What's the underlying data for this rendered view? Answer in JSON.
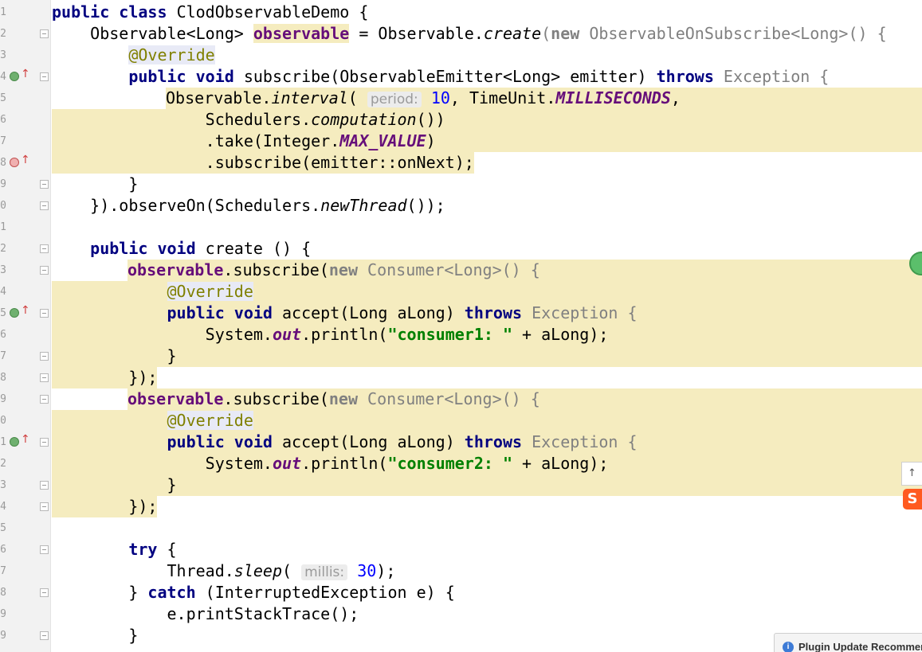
{
  "gutter": {
    "line_numbers": [
      "1",
      "2",
      "3",
      "4",
      "5",
      "6",
      "7",
      "8",
      "9",
      "0",
      "1",
      "2",
      "3",
      "4",
      "5",
      "6",
      "7",
      "8",
      "9",
      "0",
      "1",
      "2",
      "3",
      "4",
      "5",
      "6",
      "7",
      "8",
      "9",
      "9"
    ]
  },
  "code": {
    "l1": [
      "public",
      "class",
      "ClodObservableDemo {"
    ],
    "l2": [
      "Observable<Long> ",
      "observable",
      " = Observable.",
      "create",
      "(",
      "new",
      " ObservableOnSubscribe<Long>() {"
    ],
    "l3": [
      "@Override"
    ],
    "l4": [
      "public",
      "void",
      " subscribe(ObservableEmitter<Long> emitter) ",
      "throws",
      " Exception {"
    ],
    "l5": [
      "Observable.",
      "interval",
      "(",
      "period:",
      "10",
      ", TimeUnit.",
      "MILLISECONDS",
      ","
    ],
    "l6": [
      "Schedulers.",
      "computation",
      "())"
    ],
    "l7": [
      ".take(Integer.",
      "MAX_VALUE",
      ")"
    ],
    "l8": [
      ".subscribe(emitter::onNext);"
    ],
    "l9": [
      "}"
    ],
    "l10": [
      "}).observeOn(Schedulers.",
      "newThread",
      "());"
    ],
    "l12": [
      "public",
      "void",
      " create () {"
    ],
    "l13": [
      "observable",
      ".subscribe(",
      "new",
      " Consumer<Long>() {"
    ],
    "l14": [
      "@Override"
    ],
    "l15": [
      "public",
      "void",
      " accept(Long aLong) ",
      "throws",
      " Exception {"
    ],
    "l16": [
      "System.",
      "out",
      ".println(",
      "\"consumer1: \"",
      " + aLong);"
    ],
    "l17": [
      "}"
    ],
    "l18": [
      "});"
    ],
    "l19": [
      "observable",
      ".subscribe(",
      "new",
      " Consumer<Long>() {"
    ],
    "l20": [
      "@Override"
    ],
    "l21": [
      "public",
      "void",
      " accept(Long aLong) ",
      "throws",
      " Exception {"
    ],
    "l22": [
      "System.",
      "out",
      ".println(",
      "\"consumer2: \"",
      " + aLong);"
    ],
    "l23": [
      "}"
    ],
    "l24": [
      "});"
    ],
    "l26": [
      "try",
      " {"
    ],
    "l27": [
      "Thread.",
      "sleep",
      "(",
      "millis:",
      "30",
      ");"
    ],
    "l28": [
      "} ",
      "catch",
      " (InterruptedException e) {"
    ],
    "l29": [
      "e.printStackTrace();"
    ],
    "l30": [
      "}"
    ]
  },
  "side": {
    "arrow_label": "↑",
    "logo_label": "S"
  },
  "notification": {
    "text": "Plugin Update Recommen",
    "icon": "info-icon"
  },
  "colors": {
    "keyword": "#000080",
    "field": "#660e7a",
    "string": "#008000",
    "number": "#0000ff",
    "highlight": "#f5ecbf"
  }
}
